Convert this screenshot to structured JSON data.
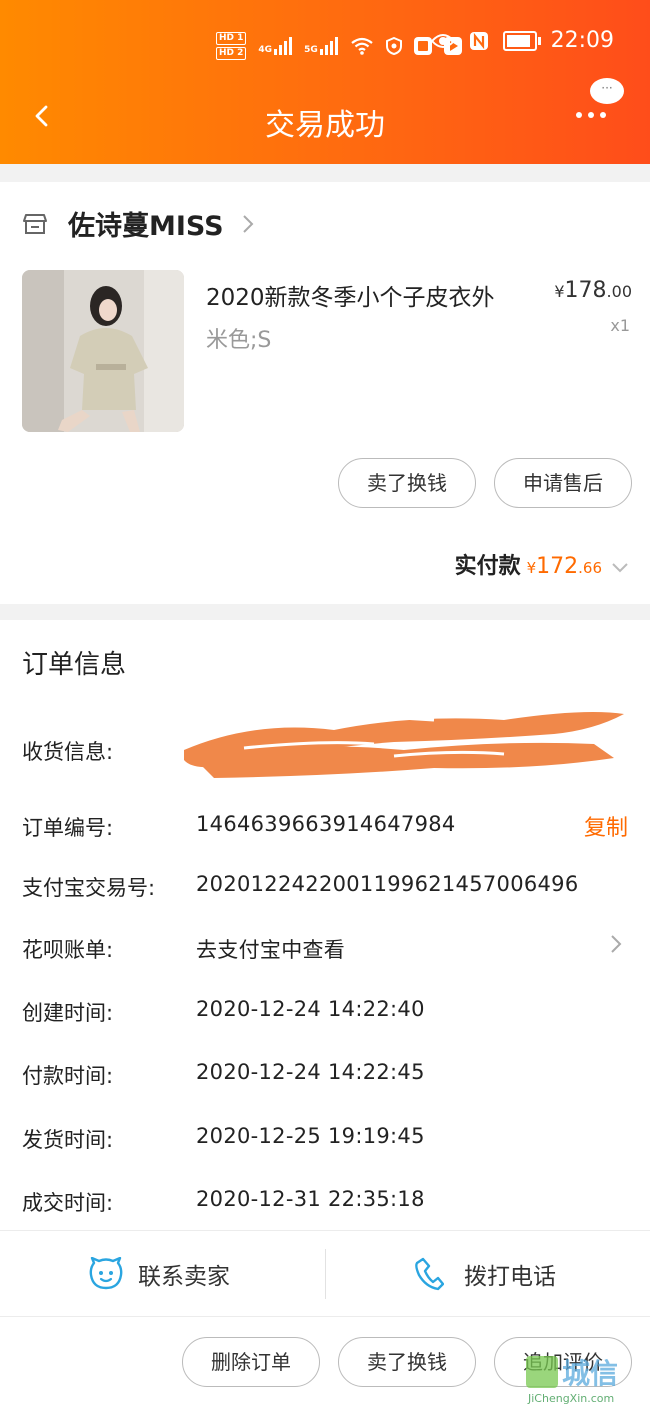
{
  "status_bar": {
    "hd1": "HD 1",
    "hd2": "HD 2",
    "net1": "4G",
    "net2": "5G",
    "time": "22:09"
  },
  "nav": {
    "title": "交易成功",
    "bubble": "···"
  },
  "order": {
    "shop_name": "佐诗蔓MISS",
    "product_title": "2020新款冬季小个子皮衣外",
    "variant": "米色;S",
    "price_symbol": "¥",
    "price_int": "178",
    "price_dec": ".00",
    "quantity": "x1",
    "buttons": [
      "卖了换钱",
      "申请售后"
    ],
    "total_label": "实付款",
    "total_symbol": "¥",
    "total_int": "172",
    "total_dec": ".66"
  },
  "info": {
    "section_title": "订单信息",
    "rows": [
      {
        "label": "收货信息:",
        "value": ""
      },
      {
        "label": "订单编号:",
        "value": "1464639663914647984",
        "action": "复制"
      },
      {
        "label": "支付宝交易号:",
        "value": "2020122422001199621457006496"
      },
      {
        "label": "花呗账单:",
        "value": "去支付宝中查看"
      },
      {
        "label": "创建时间:",
        "value": "2020-12-24 14:22:40"
      },
      {
        "label": "付款时间:",
        "value": "2020-12-24 14:22:45"
      },
      {
        "label": "发货时间:",
        "value": "2020-12-25 19:19:45"
      },
      {
        "label": "成交时间:",
        "value": "2020-12-31 22:35:18"
      }
    ]
  },
  "contact": {
    "seller": "联系卖家",
    "phone": "拨打电话"
  },
  "bottom_actions": [
    "删除订单",
    "卖了换钱",
    "追加评价"
  ],
  "watermark": {
    "text": "城信",
    "url": "JiChengXin.com"
  },
  "colors": {
    "brand_orange": "#ff6a00",
    "header_start": "#ff8a00",
    "header_end": "#ff4d1a",
    "icon_blue": "#2aa5e0",
    "scribble": "#f0884a"
  }
}
